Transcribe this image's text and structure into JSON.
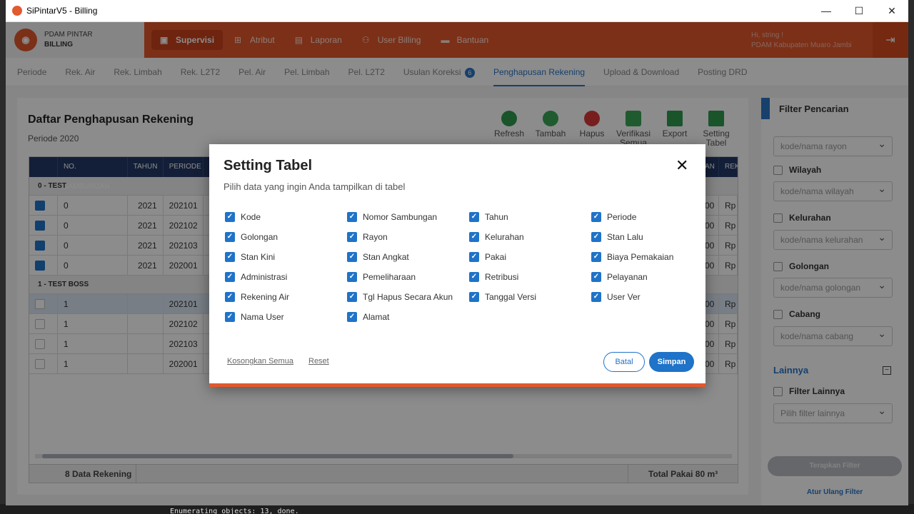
{
  "window": {
    "title": "SiPintarV5 - Billing"
  },
  "brand": {
    "line1": "PDAM PINTAR",
    "line2": "BILLING"
  },
  "topnav": [
    {
      "label": "Supervisi",
      "active": true
    },
    {
      "label": "Atribut",
      "active": false
    },
    {
      "label": "Laporan",
      "active": false
    },
    {
      "label": "User Billing",
      "active": false
    },
    {
      "label": "Bantuan",
      "active": false
    }
  ],
  "user": {
    "greeting": "Hi, string !",
    "org": "PDAM Kabupaten Muaro Jambi"
  },
  "subnav": {
    "items": [
      "Periode",
      "Rek. Air",
      "Rek. Limbah",
      "Rek. L2T2",
      "Pel. Air",
      "Pel. Limbah",
      "Pel. L2T2",
      "Usulan Koreksi",
      "Penghapusan Rekening",
      "Upload & Download",
      "Posting DRD"
    ],
    "badge": "6",
    "active": "Penghapusan Rekening"
  },
  "panel": {
    "title": "Daftar Penghapusan Rekening",
    "subtitle": "Periode 2020",
    "toolbar": [
      "Refresh",
      "Tambah",
      "Hapus",
      "Verifikasi Semua",
      "Export",
      "Setting Tabel"
    ]
  },
  "table": {
    "headers": [
      "NO. SAMBUNGAN",
      "TAHUN",
      "PERIODE",
      "AN",
      "REK"
    ],
    "groups": [
      {
        "label": "0 - TEST",
        "rows": [
          {
            "no": "0",
            "tahun": "2021",
            "periode": "202101",
            "an": "00",
            "rek": "Rp"
          },
          {
            "no": "0",
            "tahun": "2021",
            "periode": "202102",
            "an": "00",
            "rek": "Rp"
          },
          {
            "no": "0",
            "tahun": "2021",
            "periode": "202103",
            "an": "00",
            "rek": "Rp"
          },
          {
            "no": "0",
            "tahun": "2021",
            "periode": "202001",
            "an": "00",
            "rek": "Rp"
          }
        ]
      },
      {
        "label": "1 - TEST BOSS",
        "rows": [
          {
            "no": "1",
            "tahun": "",
            "periode": "202101",
            "an": "00",
            "rek": "Rp"
          },
          {
            "no": "1",
            "tahun": "",
            "periode": "202102",
            "an": "00",
            "rek": "Rp"
          },
          {
            "no": "1",
            "tahun": "",
            "periode": "202103",
            "an": "00",
            "rek": "Rp"
          },
          {
            "no": "1",
            "tahun": "",
            "periode": "202001",
            "an": "00",
            "rek": "Rp"
          }
        ]
      }
    ],
    "footer_count": "8 Data Rekening",
    "footer_total": "Total Pakai 80 m³"
  },
  "filter": {
    "title": "Filter Pencarian",
    "rayon_placeholder": "kode/nama rayon",
    "wilayah_label": "Wilayah",
    "wilayah_placeholder": "kode/nama wilayah",
    "kelurahan_label": "Kelurahan",
    "kelurahan_placeholder": "kode/nama kelurahan",
    "golongan_label": "Golongan",
    "golongan_placeholder": "kode/nama golongan",
    "cabang_label": "Cabang",
    "cabang_placeholder": "kode/nama cabang",
    "lainnya_title": "Lainnya",
    "lainnya_label": "Filter Lainnya",
    "lainnya_placeholder": "Pilih filter lainnya",
    "apply": "Terapkan Filter",
    "reset": "Atur Ulang Filter"
  },
  "modal": {
    "title": "Setting Tabel",
    "description": "Pilih data yang ingin Anda tampilkan di tabel",
    "options": [
      "Kode",
      "Nomor Sambungan",
      "Tahun",
      "Periode",
      "Golongan",
      "Rayon",
      "Kelurahan",
      "Stan Lalu",
      "Stan Kini",
      "Stan Angkat",
      "Pakai",
      "Biaya Pemakaian",
      "Administrasi",
      "Pemeliharaan",
      "Retribusi",
      "Pelayanan",
      "Rekening Air",
      "Tgl Hapus Secara Akun",
      "Tanggal Versi",
      "User Ver",
      "Nama User",
      "Alamat"
    ],
    "clear_all": "Kosongkan Semua",
    "reset": "Reset",
    "cancel": "Batal",
    "save": "Simpan"
  },
  "console": {
    "text": "Enumerating objects: 13, done."
  },
  "colors": {
    "accent": "#e2582c",
    "primary": "#1f73c8",
    "header_dark": "#243a66"
  }
}
